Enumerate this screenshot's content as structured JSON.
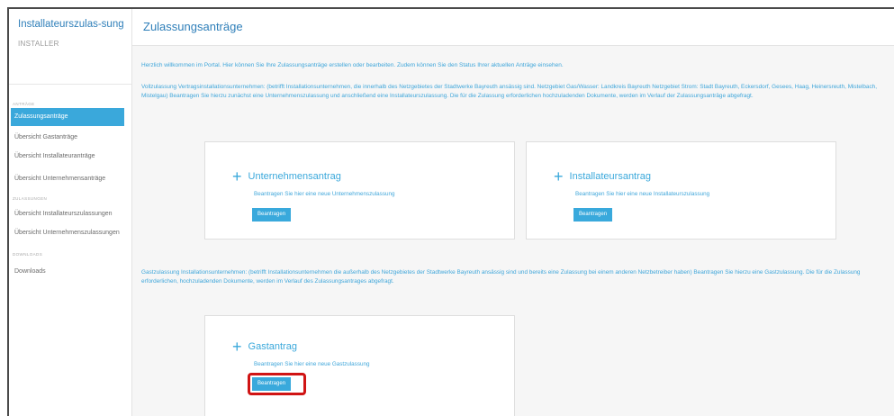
{
  "sidebar": {
    "brand_title": "Installateurszulas-sung",
    "brand_subtitle": "INSTALLER",
    "sections": [
      "ANTRÄGE",
      "ZULASSUNGEN",
      "DOWNLOADS"
    ],
    "items": [
      {
        "label": "Zulassungsanträge",
        "active": true
      },
      {
        "label": "Übersicht Gastanträge"
      },
      {
        "label": "Übersicht Installateuranträge"
      },
      {
        "label": "Übersicht Unternehmensanträge"
      },
      {
        "label": "Übersicht Installateurszulassungen"
      },
      {
        "label": "Übersicht Unternehmenszulassungen"
      },
      {
        "label": "Downloads"
      }
    ]
  },
  "header": {
    "title": "Zulassungsanträge"
  },
  "main": {
    "intro": "Herzlich willkommen im Portal. Hier können Sie Ihre Zulassungsanträge erstellen oder bearbeiten. Zudem können Sie den Status Ihrer aktuellen Anträge einsehen.",
    "para_full": "Vollzulassung Vertragsinstallationsunternehmen: (betrifft Installationsunternehmen, die innerhalb des Netzgebietes der Stadtwerke Bayreuth ansässig sind. Netzgebiet Gas/Wasser: Landkreis Bayreuth Netzgebiet Strom: Stadt Bayreuth, Eckersdorf, Gesees, Haag, Heinersreuth, Mistelbach, Mistelgau) Beantragen Sie hierzu zunächst eine Unternehmenszulassung und anschließend eine Installateurszulassung. Die für die Zulassung erforderlichen hochzuladenden Dokumente, werden im Verlauf der Zulassungsanträge abgefragt.",
    "para_guest": "Gastzulassung Installationsunternehmen: (betrifft Installationsunternehmen die außerhalb des Netzgebietes der Stadtwerke Bayreuth ansässig sind und bereits eine Zulassung bei einem anderen Netzbetreiber haben) Beantragen Sie hierzu eine Gastzulassung. Die für die Zulassung erforderlichen, hochzuladenden Dokumente, werden im Verlauf des Zulassungsantrages abgefragt.",
    "cards": [
      {
        "title": "Unternehmensantrag",
        "desc": "Beantragen Sie hier eine neue Unternehmenszulassung",
        "button": "Beantragen"
      },
      {
        "title": "Installateursantrag",
        "desc": "Beantragen Sie hier eine neue Installateurszulassung",
        "button": "Beantragen"
      },
      {
        "title": "Gastantrag",
        "desc": "Beantragen Sie hier eine neue Gastzulassung",
        "button": "Beantragen"
      }
    ]
  },
  "colors": {
    "accent": "#39a9dc",
    "highlight": "#d01414"
  }
}
